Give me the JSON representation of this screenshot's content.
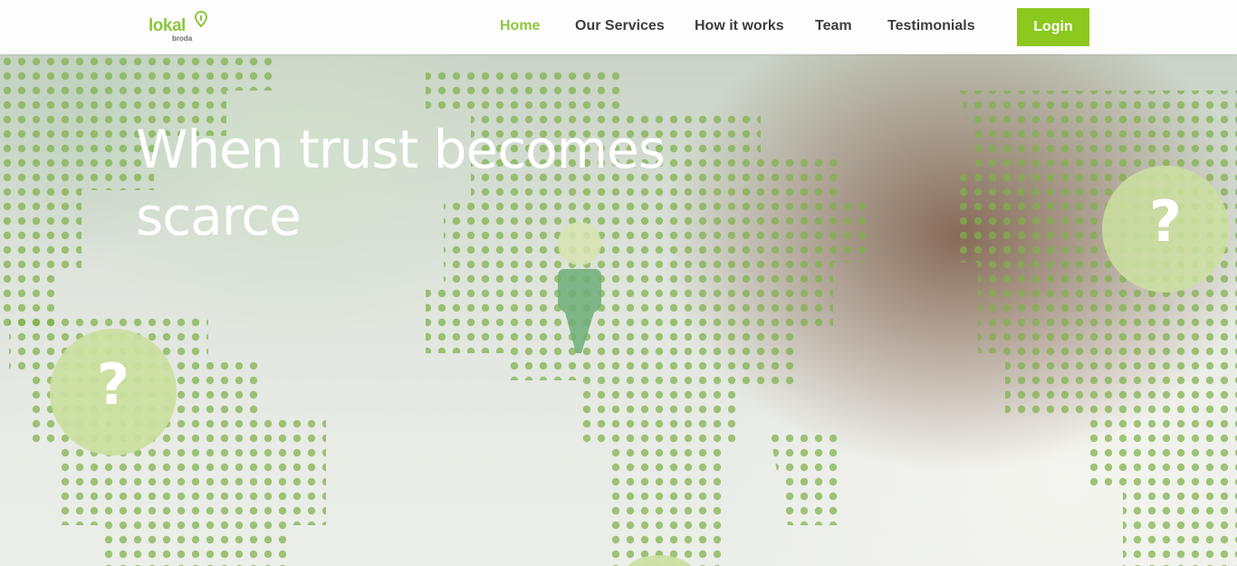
{
  "brand": {
    "logo_main": "lokal",
    "logo_sub": "broda"
  },
  "nav": {
    "items": [
      {
        "label": "Home",
        "active": true
      },
      {
        "label": "Our Services",
        "active": false
      },
      {
        "label": "How it works",
        "active": false
      },
      {
        "label": "Team",
        "active": false
      },
      {
        "label": "Testimonials",
        "active": false
      }
    ],
    "login_label": "Login"
  },
  "hero": {
    "headline": "When trust becomes scarce",
    "bubble_glyph": "?"
  },
  "colors": {
    "accent": "#8cc63f",
    "button": "#8cc81e",
    "nav_text": "#3d3d3d",
    "dot": "#7fb24a"
  },
  "icons": [
    "location-pin-icon",
    "question-bubble-icon",
    "person-marker-icon"
  ]
}
